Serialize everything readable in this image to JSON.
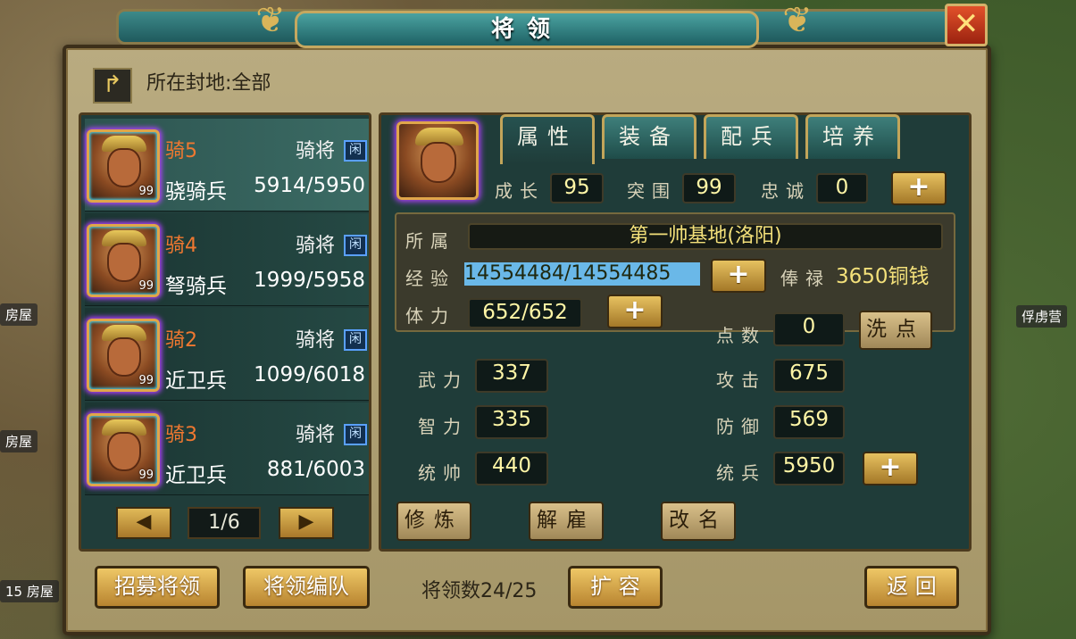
{
  "window": {
    "title": "将领",
    "close_icon": "✕"
  },
  "side_labels": [
    "房屋",
    "房屋",
    "15 房屋",
    "俘虏营"
  ],
  "fief": {
    "label": "所在封地:全部",
    "back_icon": "↱"
  },
  "generals": [
    {
      "name": "骑5",
      "class": "骑将",
      "status": "闲",
      "troop": "骁骑兵",
      "count": "5914/5950",
      "level": "99"
    },
    {
      "name": "骑4",
      "class": "骑将",
      "status": "闲",
      "troop": "弩骑兵",
      "count": "1999/5958",
      "level": "99"
    },
    {
      "name": "骑2",
      "class": "骑将",
      "status": "闲",
      "troop": "近卫兵",
      "count": "1099/6018",
      "level": "99"
    },
    {
      "name": "骑3",
      "class": "骑将",
      "status": "闲",
      "troop": "近卫兵",
      "count": "881/6003",
      "level": "99"
    }
  ],
  "pager": {
    "prev_icon": "◀",
    "text": "1/6",
    "next_icon": "▶"
  },
  "tabs": [
    "属性",
    "装备",
    "配兵",
    "培养"
  ],
  "growth": {
    "growth_label": "成长",
    "growth": "95",
    "breakout_label": "突围",
    "breakout": "99",
    "loyalty_label": "忠诚",
    "loyalty": "0"
  },
  "plus": "+",
  "detail": {
    "affiliation_label": "所属",
    "affiliation": "第一帅基地(洛阳)",
    "exp_label": "经验",
    "exp": "14554484/14554485",
    "salary_label": "俸禄",
    "salary": "3650铜钱",
    "stamina_label": "体力",
    "stamina": "652/652",
    "points_label": "点数",
    "points": "0",
    "wash_label": "洗点"
  },
  "stats": {
    "force_label": "武力",
    "force": "337",
    "intel_label": "智力",
    "intel": "335",
    "command_label": "统帅",
    "command": "440",
    "attack_label": "攻击",
    "attack": "675",
    "defense_label": "防御",
    "defense": "569",
    "troops_label": "统兵",
    "troops": "5950"
  },
  "actions": {
    "train": "修炼",
    "dismiss": "解雇",
    "rename": "改名"
  },
  "footer": {
    "recruit": "招募将领",
    "formation": "将领编队",
    "count": "将领数24/25",
    "expand": "扩 容",
    "back": "返 回"
  }
}
